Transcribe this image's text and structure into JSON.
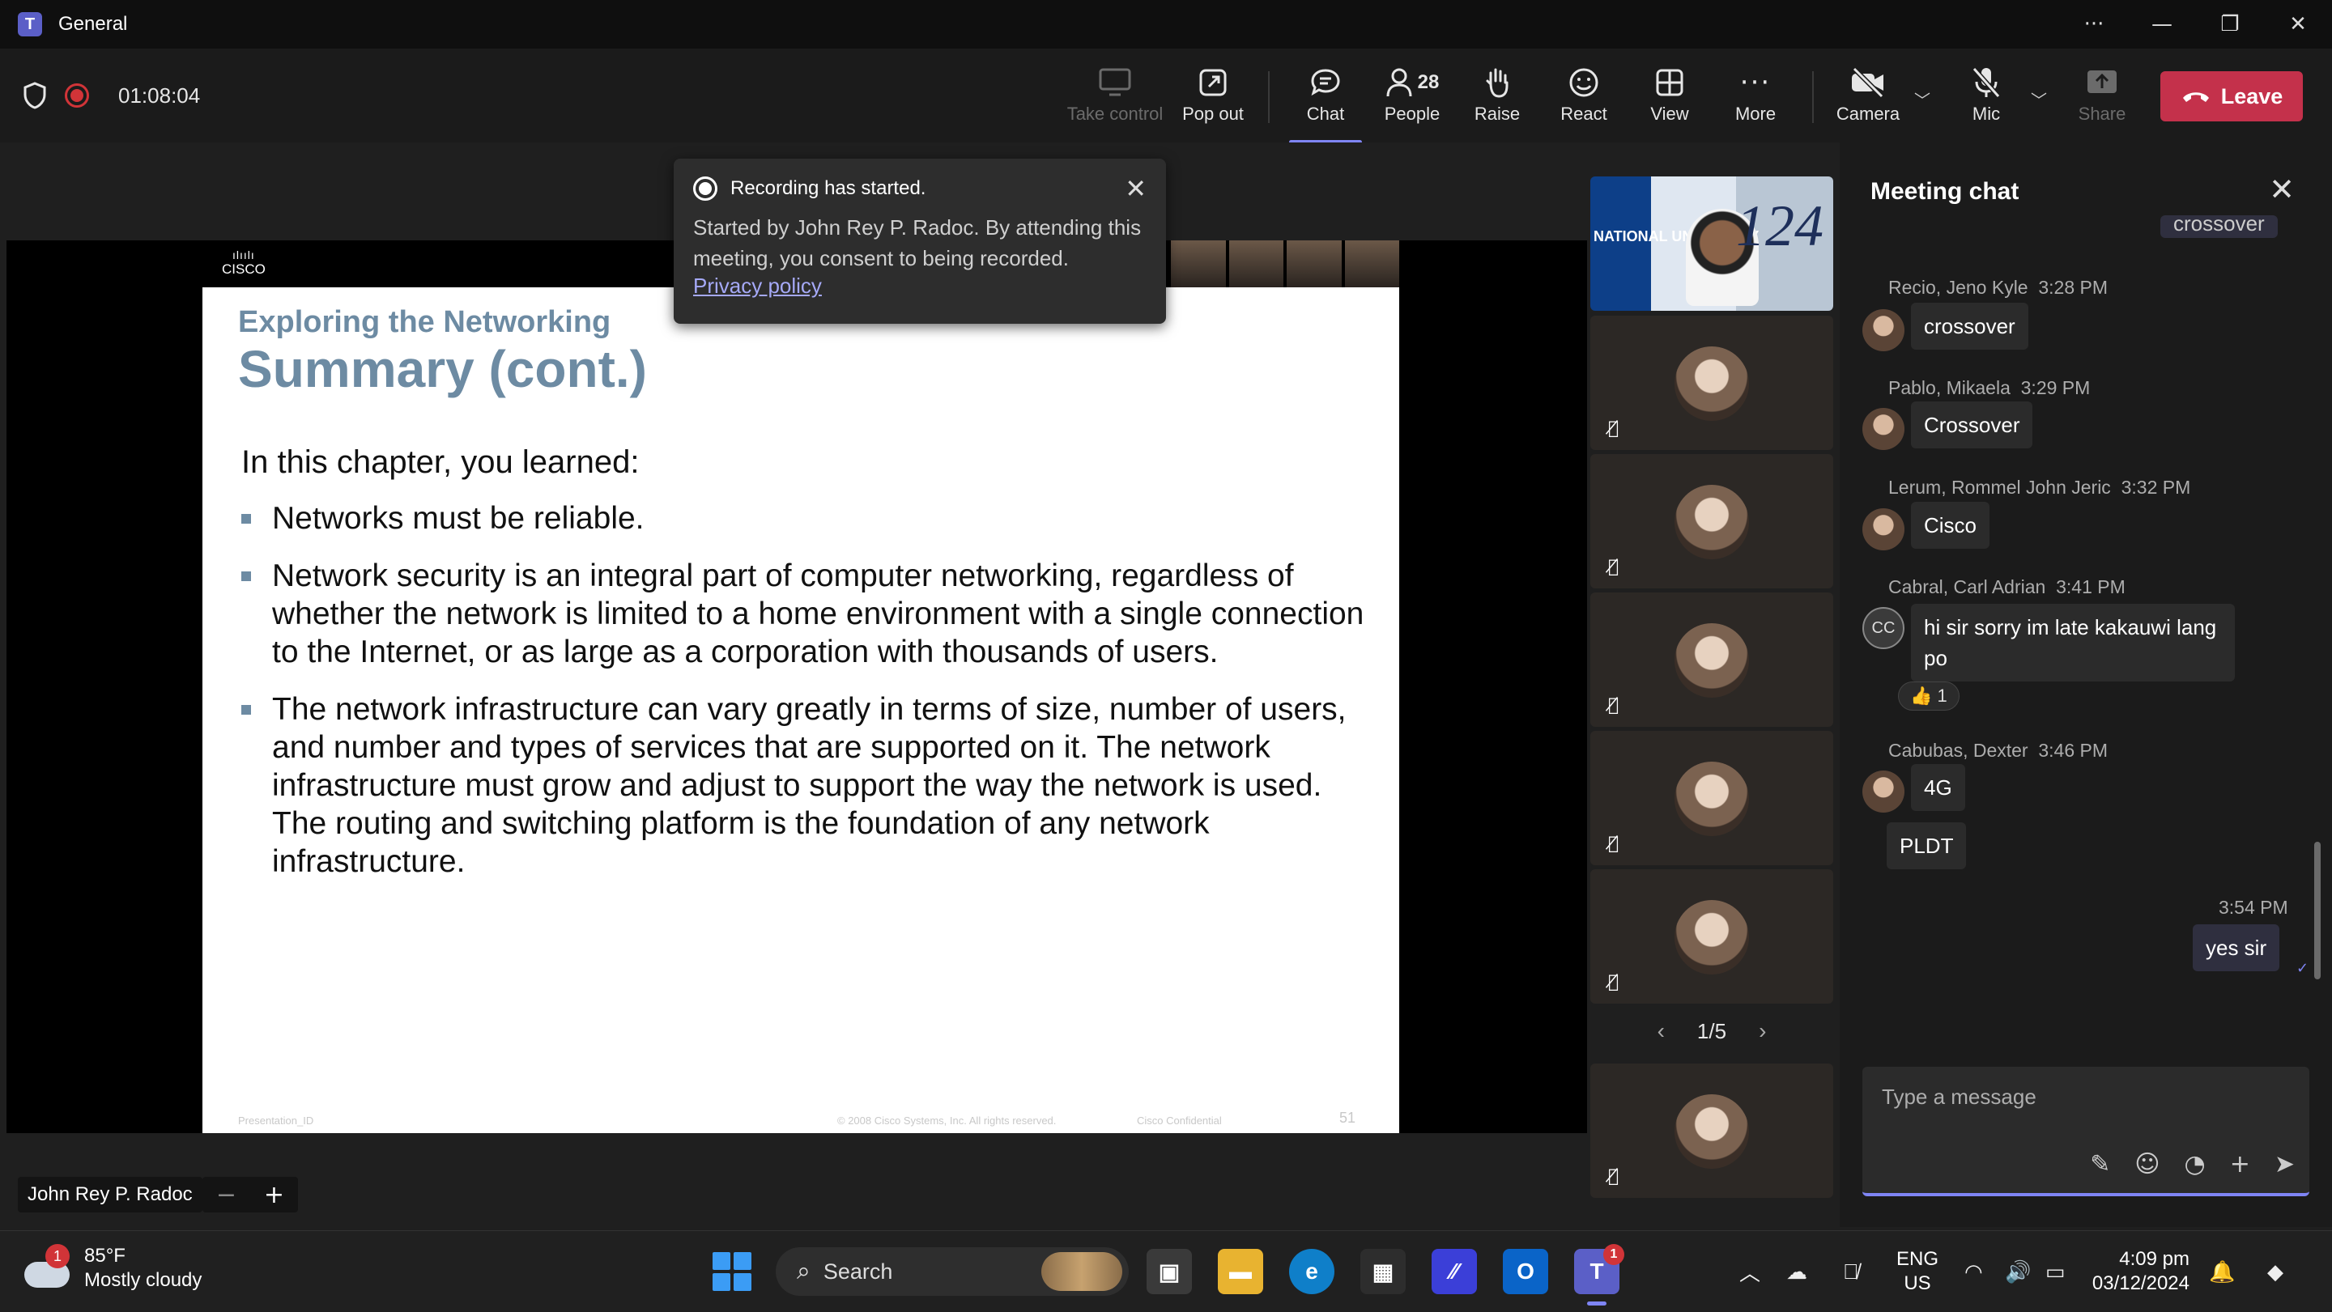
{
  "window": {
    "title": "General"
  },
  "meeting": {
    "timer": "01:08:04"
  },
  "toolbar": {
    "take_control": "Take control",
    "pop_out": "Pop out",
    "chat": "Chat",
    "people": "People",
    "people_count": "28",
    "raise": "Raise",
    "react": "React",
    "view": "View",
    "more": "More",
    "camera": "Camera",
    "mic": "Mic",
    "share": "Share",
    "leave": "Leave"
  },
  "toast": {
    "title": "Recording has started.",
    "body": "Started by John Rey P. Radoc. By attending this meeting, you consent to being recorded.",
    "link": "Privacy policy"
  },
  "slide": {
    "logo": "CISCO",
    "kicker": "Exploring the Networking",
    "title": "Summary (cont.)",
    "intro": "In this chapter, you learned:",
    "bullets": [
      "Networks must be reliable.",
      "Network security is an integral part of computer networking, regardless of whether the network is limited to a home environment with a single connection to the Internet, or as large as a corporation with thousands of users.",
      "The network infrastructure can vary greatly in terms of size, number of users, and number and types of services that are supported on it. The network infrastructure must grow and adjust to support the way the network is used. The routing and switching platform is the foundation of any network infrastructure."
    ],
    "footer_left": "Presentation_ID",
    "footer_mid": "© 2008 Cisco Systems, Inc. All rights reserved.",
    "footer_right": "Cisco Confidential",
    "page_number": "51"
  },
  "video_tile": {
    "text": "NATIONAL UNIVERSITY",
    "number": "124"
  },
  "tiles_pager": {
    "label": "1/5"
  },
  "presenter": {
    "name": "John Rey P. Radoc"
  },
  "chat": {
    "title": "Meeting chat",
    "partial_message": "crossover",
    "messages": [
      {
        "author": "Recio, Jeno Kyle",
        "time": "3:28 PM",
        "text": "crossover"
      },
      {
        "author": "Pablo, Mikaela",
        "time": "3:29 PM",
        "text": "Crossover"
      },
      {
        "author": "Lerum, Rommel John Jeric",
        "time": "3:32 PM",
        "text": "Cisco"
      },
      {
        "author": "Cabral, Carl Adrian",
        "time": "3:41 PM",
        "text": "hi sir sorry im late kakauwi lang po",
        "initials": "CC",
        "reaction": "👍 1"
      },
      {
        "author": "Cabubas, Dexter",
        "time": "3:46 PM",
        "text": "4G",
        "text2": "PLDT"
      }
    ],
    "my_message": {
      "time": "3:54 PM",
      "text": "yes sir"
    },
    "composer_placeholder": "Type a message"
  },
  "taskbar": {
    "weather_temp": "85°F",
    "weather_desc": "Mostly cloudy",
    "weather_badge": "1",
    "search": "Search",
    "teams_badge": "1",
    "lang_1": "ENG",
    "lang_2": "US",
    "time": "4:09 pm",
    "date": "03/12/2024"
  }
}
